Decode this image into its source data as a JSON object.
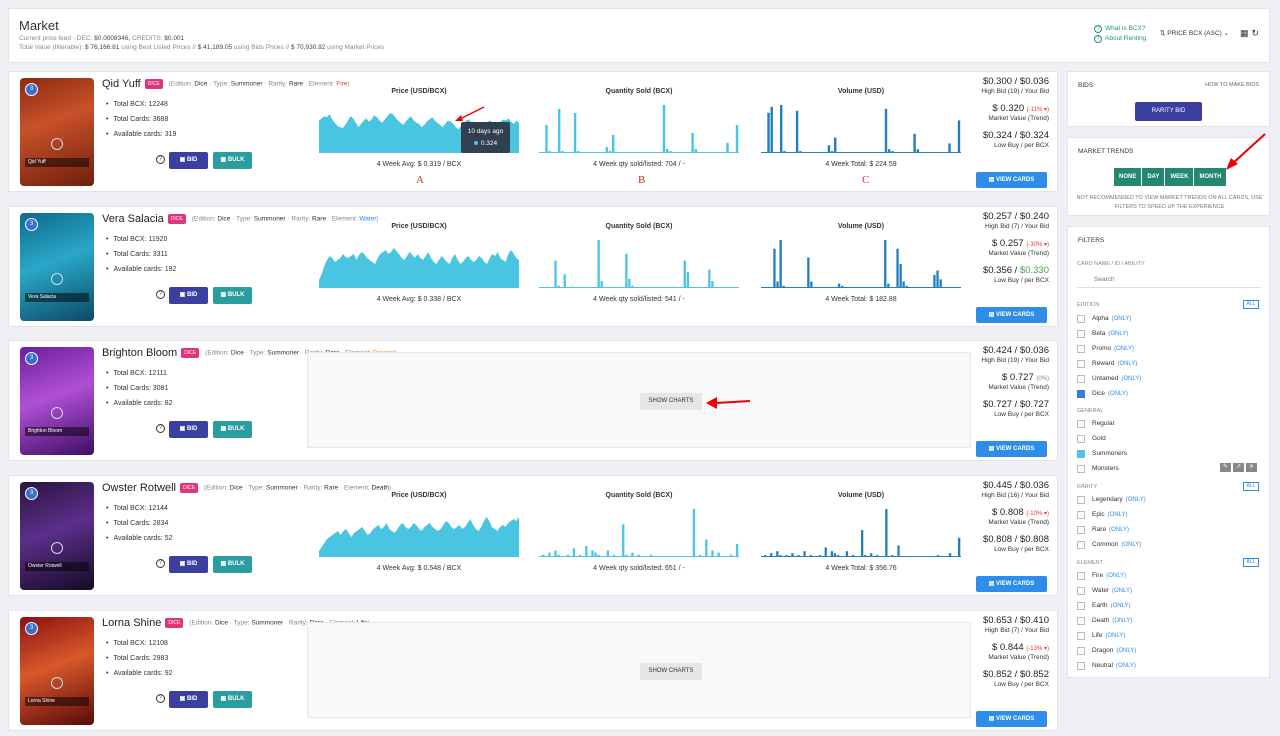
{
  "header": {
    "title": "Market",
    "feed_label": "Current price feed - DEC:",
    "dec": "$0.0008346,",
    "credits_label": "CREDITS:",
    "credits": "$0.001",
    "total_label": "Total Value (filterable):",
    "v1": "$ 76,166.81",
    "t1": "using Best Listed Prices //",
    "v2": "$ 41,189.05",
    "t2": "using Bids Prices //",
    "v3": "$ 70,930.92",
    "t3": "using Market Prices",
    "what_bcx": "What is BCX?",
    "about_renting": "About Renting",
    "sort": "PRICE BCX (ASC)",
    "sort_icon": "sort-icon",
    "grid_icon": "grid-icon",
    "refresh_icon": "refresh-icon"
  },
  "labels": {
    "edition": "(Edition:",
    "type": "Type:",
    "rarity": "Rarity:",
    "element": "Element:",
    "total_bcx": "Total BCX:",
    "total_cards": "Total Cards:",
    "available": "Available cards:",
    "bid": "BID",
    "bulk": "BULK",
    "price_title": "Price (USD/BCX)",
    "qty_title": "Quantity Sold (BCX)",
    "vol_title": "Volume (USD)",
    "avg": "4 Week Avg:",
    "qty_foot": "4 Week qty sold/listed:",
    "vol_foot": "4 Week Total:",
    "high_bid": "High Bid",
    "your_bid": "/ Your Bid",
    "market_value": "Market Value (Trend)",
    "low_buy": "Low Buy / per BCX",
    "view_cards": "VIEW CARDS",
    "show_charts": "SHOW CHARTS",
    "dice_badge": "DICE",
    "summoner": "Summoner",
    "rare": "Rare",
    "dice_ed": "Dice"
  },
  "cards": [
    {
      "name": "Qid Yuff",
      "element": "Fire",
      "element_color": "#e53935",
      "total_bcx": "12248",
      "total_cards": "3688",
      "available": "319",
      "avg": "$ 0.319 / BCX",
      "qty": "704 / -",
      "vol": "$ 224.59",
      "price_pair": "$0.300 / $0.036",
      "high_bid_n": "(19)",
      "market_value": "$ 0.320",
      "pct": "(-11% ▾)",
      "pct_neg": true,
      "low_buy": "$0.324 / $0.324",
      "low_green": false,
      "charts": true,
      "price_series": [
        30,
        32,
        34,
        33,
        36,
        31,
        28,
        25,
        24,
        23,
        26,
        30,
        34,
        32,
        28,
        24,
        27,
        30,
        32,
        29,
        31,
        35,
        33,
        30,
        28,
        31,
        34,
        37,
        36,
        33,
        30,
        28,
        26,
        29,
        32,
        34,
        30,
        28,
        27,
        24,
        26,
        29,
        31,
        33,
        30,
        28,
        26,
        24,
        27,
        30,
        29,
        27,
        24,
        22,
        25,
        28,
        30,
        31,
        28,
        26,
        24,
        23,
        25,
        27,
        29,
        30,
        28,
        24,
        26,
        29,
        31,
        30,
        32,
        29,
        27,
        30,
        28
      ],
      "qty_series": [
        0,
        0,
        28,
        2,
        0,
        0,
        44,
        2,
        0,
        0,
        0,
        40,
        2,
        0,
        0,
        0,
        0,
        0,
        0,
        0,
        0,
        6,
        2,
        18,
        0,
        0,
        0,
        0,
        0,
        0,
        0,
        0,
        0,
        0,
        0,
        0,
        0,
        0,
        0,
        48,
        4,
        2,
        0,
        0,
        0,
        0,
        0,
        0,
        20,
        4,
        0,
        0,
        0,
        0,
        0,
        0,
        0,
        0,
        0,
        10,
        0,
        0,
        28
      ],
      "vol_series": [
        0,
        0,
        42,
        48,
        0,
        0,
        50,
        2,
        0,
        0,
        0,
        44,
        2,
        0,
        0,
        0,
        0,
        0,
        0,
        0,
        0,
        8,
        2,
        16,
        0,
        0,
        0,
        0,
        0,
        0,
        0,
        0,
        0,
        0,
        0,
        0,
        0,
        0,
        0,
        46,
        4,
        2,
        0,
        0,
        0,
        0,
        0,
        0,
        20,
        4,
        0,
        0,
        0,
        0,
        0,
        0,
        0,
        0,
        0,
        10,
        0,
        0,
        34
      ],
      "tooltip": {
        "when": "10 days ago",
        "value": "0.324"
      }
    },
    {
      "name": "Vera Salacia",
      "element": "Water",
      "element_color": "#1e88e5",
      "total_bcx": "11920",
      "total_cards": "3311",
      "available": "192",
      "avg": "$ 0.338 / BCX",
      "qty": "541 / -",
      "vol": "$ 182.88",
      "price_pair": "$0.257 / $0.240",
      "high_bid_n": "(7)",
      "market_value": "$ 0.257",
      "pct": "(-30% ▾)",
      "pct_neg": true,
      "low_buy": "$0.356 / $0.330",
      "low_green": true,
      "charts": true,
      "price_series": [
        8,
        14,
        22,
        28,
        32,
        30,
        26,
        28,
        30,
        34,
        31,
        30,
        32,
        34,
        28,
        33,
        36,
        34,
        30,
        28,
        26,
        24,
        30,
        34,
        36,
        38,
        34,
        36,
        40,
        37,
        34,
        30,
        28,
        32,
        36,
        33,
        30,
        34,
        30,
        28,
        32,
        36,
        30,
        26,
        24,
        28,
        32,
        29,
        26,
        24,
        30,
        34,
        28,
        24,
        26,
        30,
        32,
        28,
        26,
        28,
        32,
        30,
        26,
        24,
        30,
        34,
        32,
        36,
        30,
        28,
        26,
        34,
        38,
        34,
        30,
        28
      ],
      "qty_series": [
        0,
        0,
        0,
        0,
        0,
        24,
        2,
        0,
        12,
        0,
        0,
        0,
        0,
        0,
        0,
        0,
        0,
        0,
        0,
        42,
        6,
        0,
        0,
        0,
        0,
        0,
        0,
        0,
        30,
        8,
        2,
        0,
        0,
        0,
        0,
        0,
        0,
        0,
        0,
        0,
        0,
        0,
        0,
        0,
        0,
        0,
        0,
        24,
        14,
        0,
        0,
        0,
        0,
        0,
        0,
        16,
        6,
        0,
        0,
        0,
        0,
        0,
        0,
        0,
        0
      ],
      "vol_series": [
        0,
        0,
        0,
        0,
        36,
        6,
        44,
        2,
        0,
        0,
        0,
        0,
        0,
        0,
        0,
        28,
        6,
        0,
        0,
        0,
        0,
        0,
        0,
        0,
        0,
        4,
        2,
        0,
        0,
        0,
        0,
        0,
        0,
        0,
        0,
        0,
        0,
        0,
        0,
        0,
        44,
        4,
        0,
        0,
        36,
        22,
        6,
        2,
        0,
        0,
        0,
        0,
        0,
        0,
        0,
        0,
        12,
        16,
        8,
        0,
        0,
        0,
        0,
        0,
        0
      ],
      "tooltip": null
    },
    {
      "name": "Brighton Bloom",
      "element": "Dragon",
      "element_color": "#fb8c00",
      "total_bcx": "12111",
      "total_cards": "3081",
      "available": "82",
      "avg": "",
      "qty": "",
      "vol": "",
      "price_pair": "$0.424 / $0.036",
      "high_bid_n": "(19)",
      "market_value": "$ 0.727",
      "pct": "(0%)",
      "pct_neg": false,
      "low_buy": "$0.727 / $0.727",
      "low_green": false,
      "charts": false,
      "price_series": [],
      "qty_series": [],
      "vol_series": [],
      "tooltip": null
    },
    {
      "name": "Owster Rotwell",
      "element": "Death",
      "element_color": "#222222",
      "total_bcx": "12144",
      "total_cards": "2834",
      "available": "52",
      "avg": "$ 0.548 / BCX",
      "qty": "651 / -",
      "vol": "$ 356.76",
      "price_pair": "$0.445 / $0.036",
      "high_bid_n": "(16)",
      "market_value": "$ 0.808",
      "pct": "(-10% ▾)",
      "pct_neg": true,
      "low_buy": "$0.808 / $0.808",
      "low_green": false,
      "charts": true,
      "price_series": [
        6,
        10,
        14,
        18,
        20,
        22,
        24,
        26,
        22,
        26,
        28,
        24,
        20,
        24,
        26,
        28,
        30,
        26,
        22,
        24,
        28,
        30,
        32,
        28,
        30,
        34,
        28,
        26,
        24,
        28,
        32,
        34,
        30,
        28,
        30,
        34,
        32,
        28,
        26,
        30,
        32,
        34,
        30,
        28,
        26,
        28,
        32,
        36,
        34,
        30,
        28,
        30,
        32,
        28,
        30,
        34,
        38,
        32,
        28,
        26,
        30,
        36,
        40,
        36,
        30,
        28,
        26,
        30,
        32,
        30,
        34,
        36,
        38,
        36,
        40
      ],
      "qty_series": [
        0,
        2,
        0,
        4,
        0,
        6,
        2,
        0,
        0,
        2,
        0,
        8,
        0,
        2,
        0,
        10,
        0,
        6,
        4,
        2,
        0,
        0,
        6,
        0,
        2,
        0,
        0,
        30,
        2,
        0,
        4,
        0,
        2,
        0,
        0,
        0,
        2,
        0,
        0,
        0,
        0,
        0,
        0,
        0,
        0,
        0,
        0,
        0,
        0,
        0,
        44,
        0,
        2,
        0,
        16,
        0,
        6,
        0,
        4,
        0,
        0,
        0,
        2,
        0,
        12
      ],
      "vol_series": [
        0,
        2,
        0,
        4,
        0,
        6,
        2,
        0,
        2,
        0,
        4,
        0,
        2,
        0,
        6,
        0,
        2,
        0,
        0,
        2,
        0,
        10,
        0,
        6,
        4,
        2,
        0,
        0,
        6,
        0,
        2,
        0,
        0,
        28,
        2,
        0,
        4,
        0,
        2,
        0,
        0,
        50,
        0,
        2,
        0,
        12,
        0,
        0,
        0,
        0,
        0,
        0,
        0,
        0,
        0,
        0,
        0,
        0,
        2,
        0,
        0,
        0,
        4,
        0,
        0,
        20
      ],
      "tooltip": null
    },
    {
      "name": "Lorna Shine",
      "element": "Life",
      "element_color": "#222222",
      "total_bcx": "12108",
      "total_cards": "2983",
      "available": "92",
      "avg": "",
      "qty": "",
      "vol": "",
      "price_pair": "$0.653 / $0.410",
      "high_bid_n": "(7)",
      "market_value": "$ 0.844",
      "pct": "(-13% ▾)",
      "pct_neg": true,
      "low_buy": "$0.852 / $0.852",
      "low_green": false,
      "charts": false,
      "price_series": [],
      "qty_series": [],
      "vol_series": [],
      "tooltip": null
    }
  ],
  "annotations": {
    "a": "A",
    "b": "B",
    "c": "C"
  },
  "bids": {
    "title": "BIDS",
    "how": "HOW TO MAKE BIDS",
    "button": "RARITY BID"
  },
  "trends": {
    "title": "MARKET TRENDS",
    "options": [
      "NONE",
      "DAY",
      "WEEK",
      "MONTH"
    ],
    "warning": "NOT RECOMMENDED TO VIEW MARKET TRENDS ON ALL CARDS, USE FILTERS TO SPEED UP THE EXPERIENCE"
  },
  "filters": {
    "title": "FILTERS",
    "search_label": "CARD NAME / ID / ABILITY",
    "search_placeholder": "Search",
    "edition_label": "EDITION",
    "all": "ALL",
    "only": "(ONLY)",
    "editions": [
      {
        "name": "Alpha",
        "only": true,
        "checked": false
      },
      {
        "name": "Beta",
        "only": true,
        "checked": false
      },
      {
        "name": "Promo",
        "only": true,
        "checked": false
      },
      {
        "name": "Reward",
        "only": true,
        "checked": false
      },
      {
        "name": "Untamed",
        "only": true,
        "checked": false
      },
      {
        "name": "Dice",
        "only": true,
        "checked": true
      }
    ],
    "general_label": "GENERAL",
    "general": [
      {
        "name": "Regular",
        "checked": false
      },
      {
        "name": "Gold",
        "checked": false
      },
      {
        "name": "Summoners",
        "checked": true
      },
      {
        "name": "Monsters",
        "checked": false
      }
    ],
    "rarity_label": "RARITY",
    "rarity": [
      {
        "name": "Legendary",
        "checked": false
      },
      {
        "name": "Epic",
        "checked": false
      },
      {
        "name": "Rare",
        "checked": false
      },
      {
        "name": "Common",
        "checked": false
      }
    ],
    "element_label": "ELEMENT",
    "elements": [
      {
        "name": "Fire"
      },
      {
        "name": "Water"
      },
      {
        "name": "Earth"
      },
      {
        "name": "Death"
      },
      {
        "name": "Life"
      },
      {
        "name": "Dragon"
      },
      {
        "name": "Neutral"
      }
    ]
  },
  "colors": {
    "chart": "#49c4e1",
    "volume": "#1f7fbf",
    "bid": "#3a3fa0",
    "bulk": "#2a9da0",
    "view": "#2e8de8",
    "trends": "#24886f"
  }
}
